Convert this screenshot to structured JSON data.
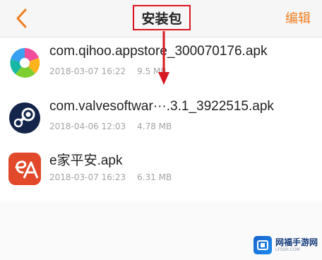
{
  "header": {
    "title": "安装包",
    "edit_label": "编辑",
    "accent_color": "#ef7c1e",
    "highlight_color": "#d8161f"
  },
  "files": [
    {
      "name": "com.qihoo.appstore_300070176.apk",
      "date": "2018-03-07 16:22",
      "size": "9.5 MB",
      "icon": "qihoo-appstore-icon"
    },
    {
      "name": "com.valvesoftwar···.3.1_3922515.apk",
      "date": "2018-04-06 12:03",
      "size": "4.78 MB",
      "icon": "steam-icon"
    },
    {
      "name": "e家平安.apk",
      "date": "2018-03-07 16:23",
      "size": "6.31 MB",
      "icon": "e-home-safety-icon"
    }
  ],
  "watermark": {
    "title": "网福手游网",
    "subtitle": "LFSSH.COM"
  }
}
